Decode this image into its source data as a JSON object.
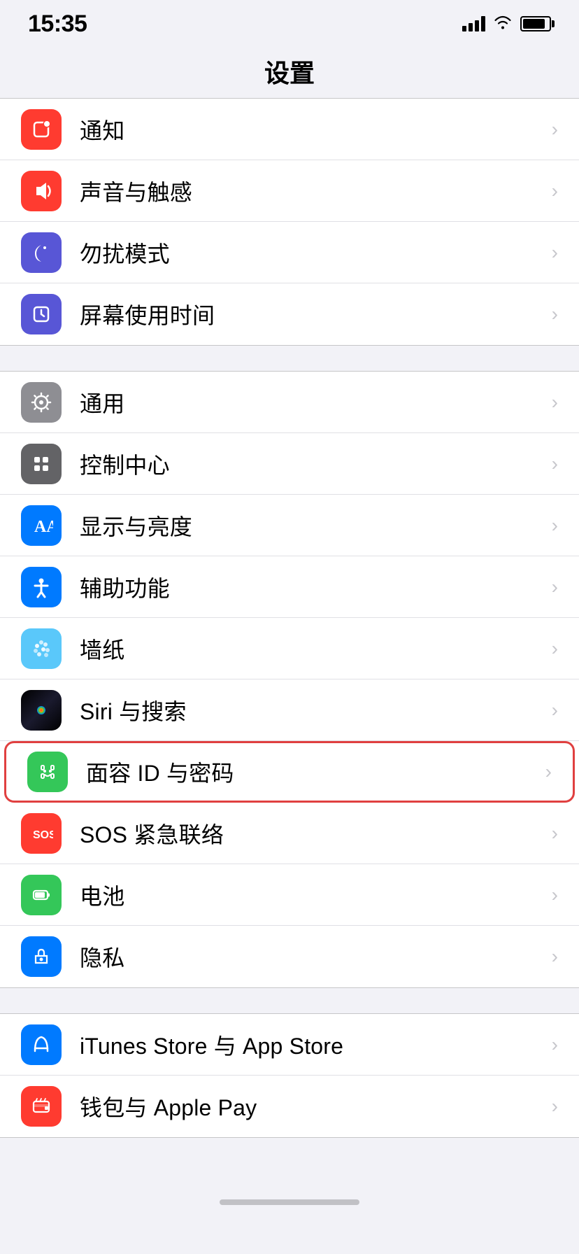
{
  "statusBar": {
    "time": "15:35",
    "icons": [
      "signal",
      "wifi",
      "battery"
    ]
  },
  "pageTitle": "设置",
  "sections": [
    {
      "id": "section1",
      "items": [
        {
          "id": "notifications",
          "label": "通知",
          "iconColor": "icon-red",
          "iconType": "notifications",
          "highlighted": false
        },
        {
          "id": "sound",
          "label": "声音与触感",
          "iconColor": "icon-red2",
          "iconType": "sound",
          "highlighted": false
        },
        {
          "id": "dnd",
          "label": "勿扰模式",
          "iconColor": "icon-purple",
          "iconType": "dnd",
          "highlighted": false
        },
        {
          "id": "screentime",
          "label": "屏幕使用时间",
          "iconColor": "icon-purple2",
          "iconType": "screentime",
          "highlighted": false
        }
      ]
    },
    {
      "id": "section2",
      "items": [
        {
          "id": "general",
          "label": "通用",
          "iconColor": "icon-gray",
          "iconType": "general",
          "highlighted": false
        },
        {
          "id": "controlcenter",
          "label": "控制中心",
          "iconColor": "icon-gray2",
          "iconType": "controlcenter",
          "highlighted": false
        },
        {
          "id": "display",
          "label": "显示与亮度",
          "iconColor": "icon-blue",
          "iconType": "display",
          "highlighted": false
        },
        {
          "id": "accessibility",
          "label": "辅助功能",
          "iconColor": "icon-blue2",
          "iconType": "accessibility",
          "highlighted": false
        },
        {
          "id": "wallpaper",
          "label": "墙纸",
          "iconColor": "icon-teal",
          "iconType": "wallpaper",
          "highlighted": false
        },
        {
          "id": "siri",
          "label": "Siri 与搜索",
          "iconColor": "icon-siri",
          "iconType": "siri",
          "highlighted": false
        },
        {
          "id": "faceid",
          "label": "面容 ID 与密码",
          "iconColor": "icon-green",
          "iconType": "faceid",
          "highlighted": true
        },
        {
          "id": "sos",
          "label": "SOS 紧急联络",
          "iconColor": "icon-dark-red",
          "iconType": "sos",
          "highlighted": false
        },
        {
          "id": "battery",
          "label": "电池",
          "iconColor": "icon-green2",
          "iconType": "battery",
          "highlighted": false
        },
        {
          "id": "privacy",
          "label": "隐私",
          "iconColor": "icon-blue",
          "iconType": "privacy",
          "highlighted": false
        }
      ]
    },
    {
      "id": "section3",
      "items": [
        {
          "id": "itunes",
          "label": "iTunes Store 与 App Store",
          "iconColor": "icon-blue",
          "iconType": "itunes",
          "highlighted": false
        },
        {
          "id": "wallet",
          "label": "钱包与 Apple Pay",
          "iconColor": "icon-dark-red",
          "iconType": "wallet",
          "highlighted": false
        }
      ]
    }
  ],
  "chevron": "›"
}
